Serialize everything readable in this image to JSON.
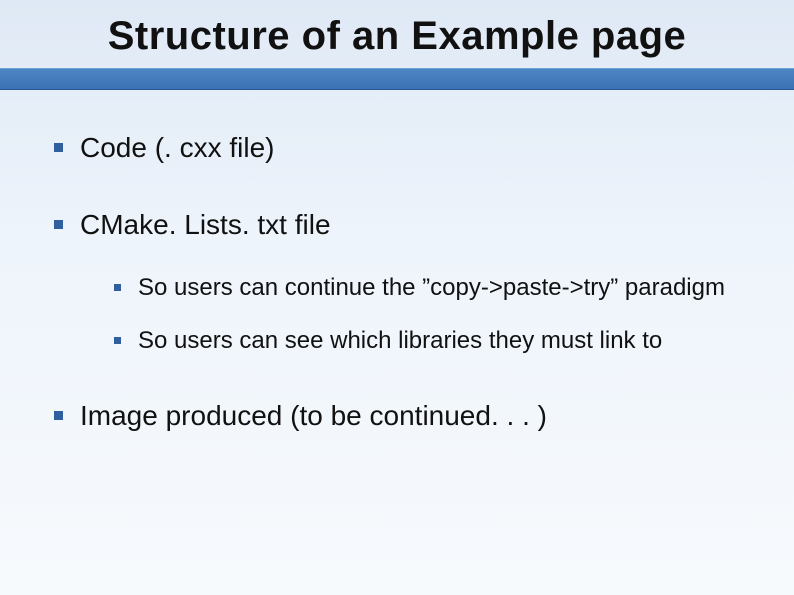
{
  "title": "Structure of an Example page",
  "bullets": [
    {
      "text": "Code (. cxx file)"
    },
    {
      "text": "CMake. Lists. txt file",
      "children": [
        {
          "text": "So users can continue the ”copy->paste->try” paradigm"
        },
        {
          "text": "So users can see which libraries they must link to"
        }
      ]
    },
    {
      "text": "Image produced (to be continued. . . )"
    }
  ]
}
